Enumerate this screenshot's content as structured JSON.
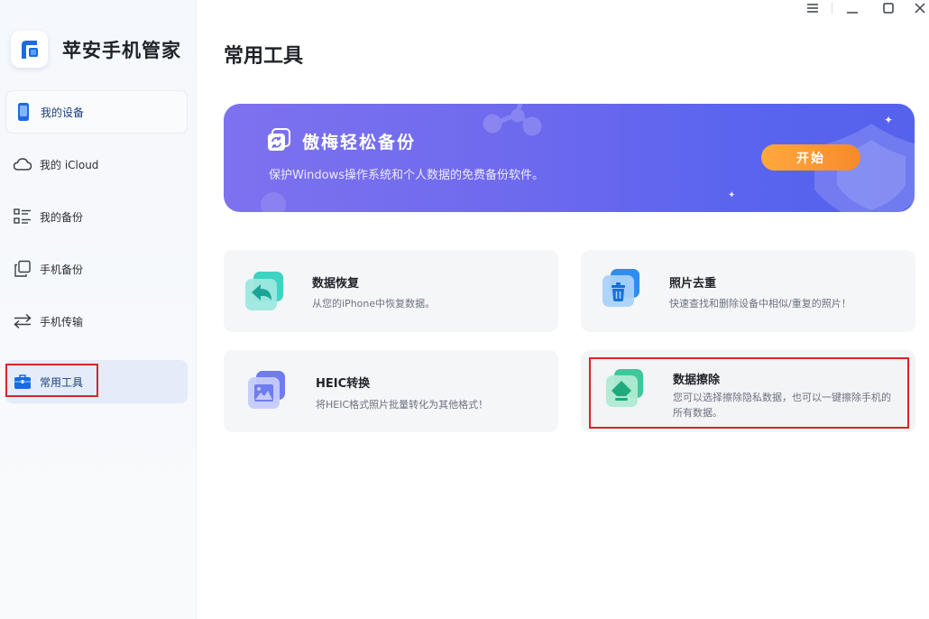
{
  "app": {
    "name": "苹安手机管家"
  },
  "sidebar": {
    "items": [
      {
        "label": "我的设备",
        "icon": "phone-icon"
      },
      {
        "label": "我的 iCloud",
        "icon": "cloud-icon"
      },
      {
        "label": "我的备份",
        "icon": "list-icon"
      },
      {
        "label": "手机备份",
        "icon": "copy-icon"
      },
      {
        "label": "手机传输",
        "icon": "transfer-icon"
      },
      {
        "label": "常用工具",
        "icon": "toolbox-icon"
      }
    ]
  },
  "main": {
    "title": "常用工具",
    "banner": {
      "title": "傲梅轻松备份",
      "subtitle": "保护Windows操作系统和个人数据的免费备份软件。",
      "button": "开始"
    },
    "tools": [
      {
        "title": "数据恢复",
        "desc": "从您的iPhone中恢复数据。",
        "icon": "undo-icon"
      },
      {
        "title": "照片去重",
        "desc": "快速查找和删除设备中相似/重复的照片！",
        "icon": "trash-icon"
      },
      {
        "title": "HEIC转换",
        "desc": "将HEIC格式照片批量转化为其他格式！",
        "icon": "image-icon"
      },
      {
        "title": "数据擦除",
        "desc": "您可以选择擦除隐私数据，也可以一键擦除手机的所有数据。",
        "icon": "eraser-icon"
      }
    ]
  },
  "colors": {
    "accent": "#1a6be0",
    "banner": "#6f6aee",
    "button": "#f78a2c",
    "highlight": "#d9242a"
  }
}
